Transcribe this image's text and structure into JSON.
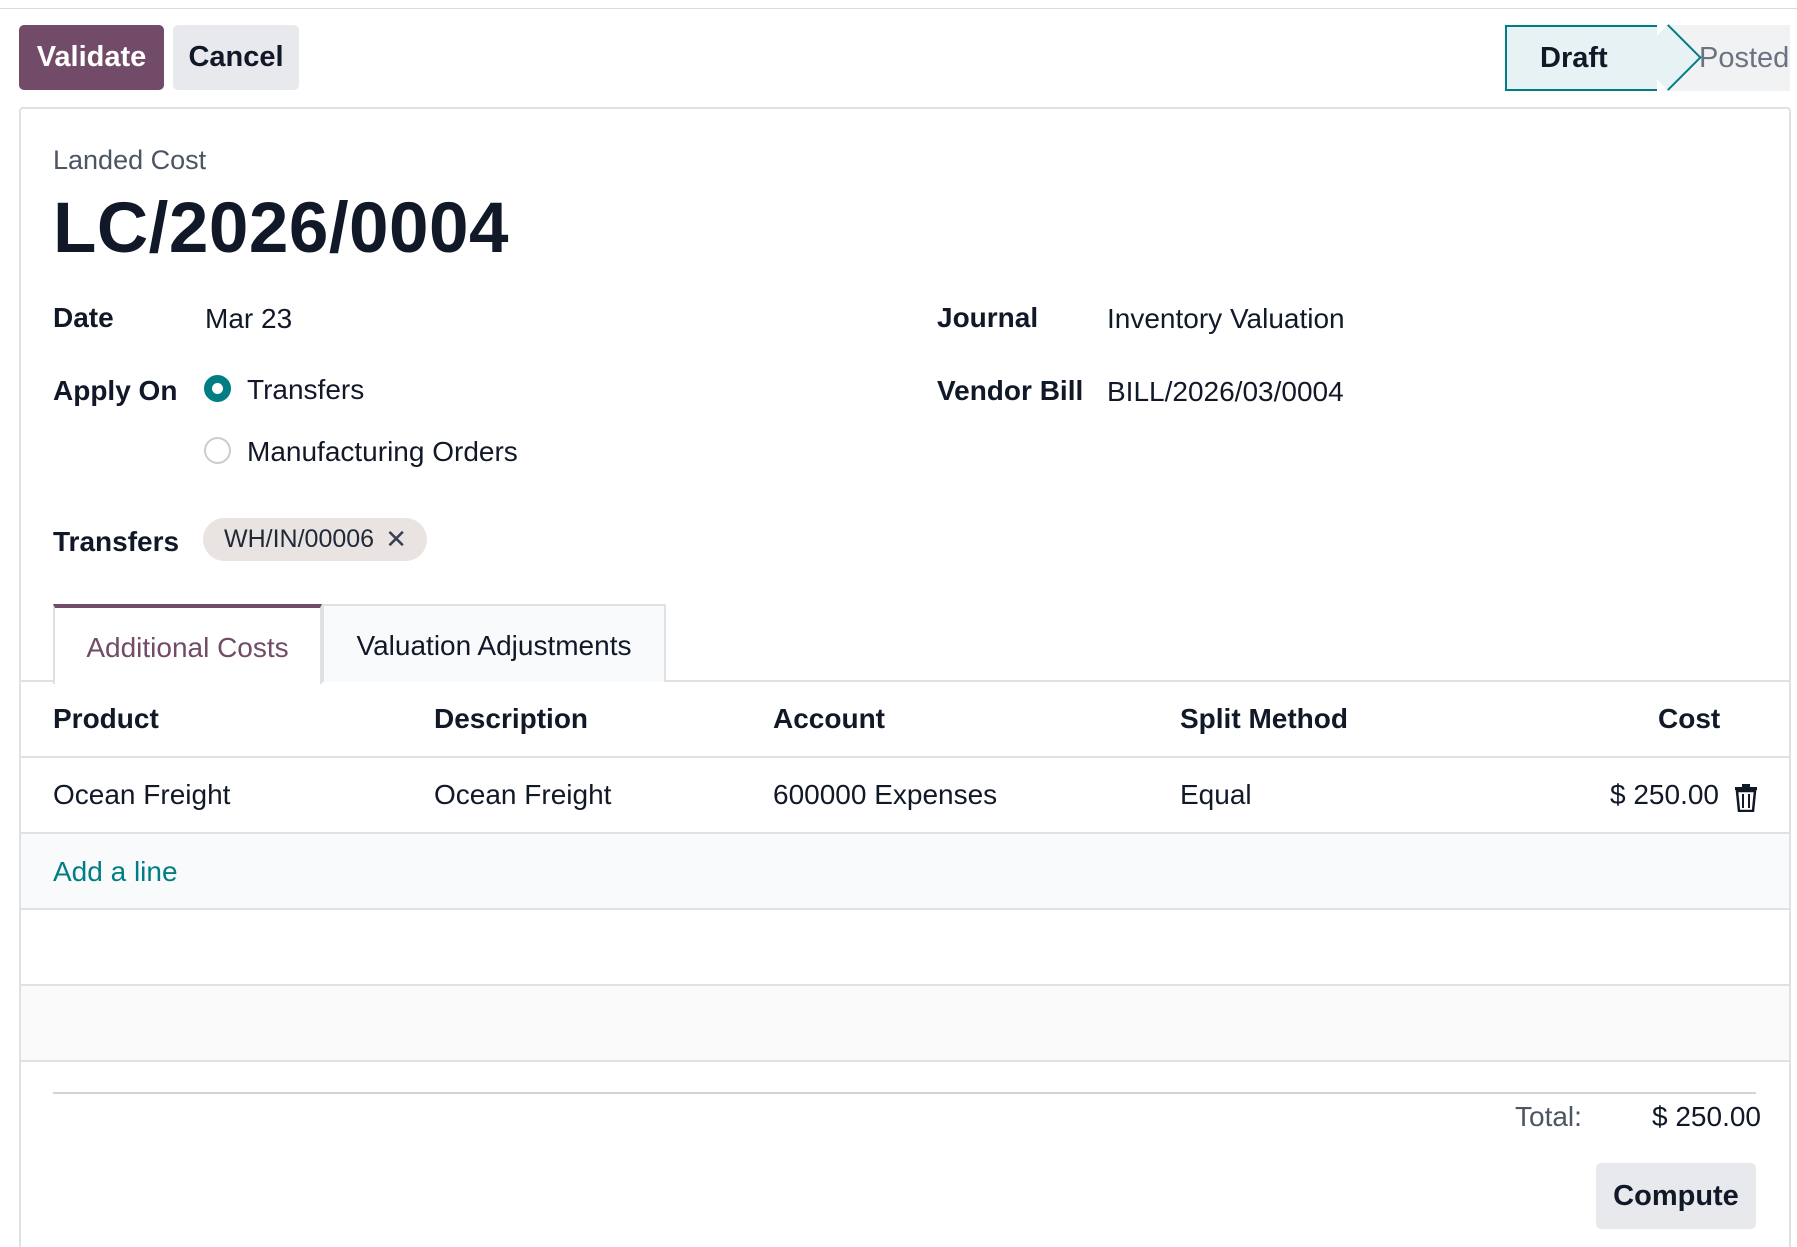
{
  "control_panel": {
    "validate_label": "Validate",
    "cancel_label": "Cancel",
    "status_steps": [
      "Draft",
      "Posted"
    ],
    "current_status": "Draft"
  },
  "form": {
    "record_type_label": "Landed Cost",
    "name": "LC/2026/0004",
    "date_label": "Date",
    "date_value": "Mar 23",
    "journal_label": "Journal",
    "journal_value": "Inventory Valuation",
    "apply_on_label": "Apply On",
    "apply_on_options": [
      "Transfers",
      "Manufacturing Orders"
    ],
    "apply_on_selected": "Transfers",
    "vendor_bill_label": "Vendor Bill",
    "vendor_bill_value": "BILL/2026/03/0004",
    "transfers_label": "Transfers",
    "transfers_tags": [
      "WH/IN/00006"
    ]
  },
  "tabs": [
    {
      "label": "Additional Costs",
      "active": true
    },
    {
      "label": "Valuation Adjustments",
      "active": false
    }
  ],
  "cost_lines": {
    "columns": [
      "Product",
      "Description",
      "Account",
      "Split Method",
      "Cost"
    ],
    "rows": [
      {
        "product": "Ocean Freight",
        "description": "Ocean Freight",
        "account": "600000 Expenses",
        "split_method": "Equal",
        "cost": "$ 250.00"
      }
    ],
    "add_line_label": "Add a line"
  },
  "totals": {
    "total_label": "Total:",
    "total_value": "$ 250.00"
  },
  "compute_label": "Compute",
  "colors": {
    "primary": "#714b67",
    "accent": "#017e84",
    "secondary_button": "#e7e9ed"
  }
}
